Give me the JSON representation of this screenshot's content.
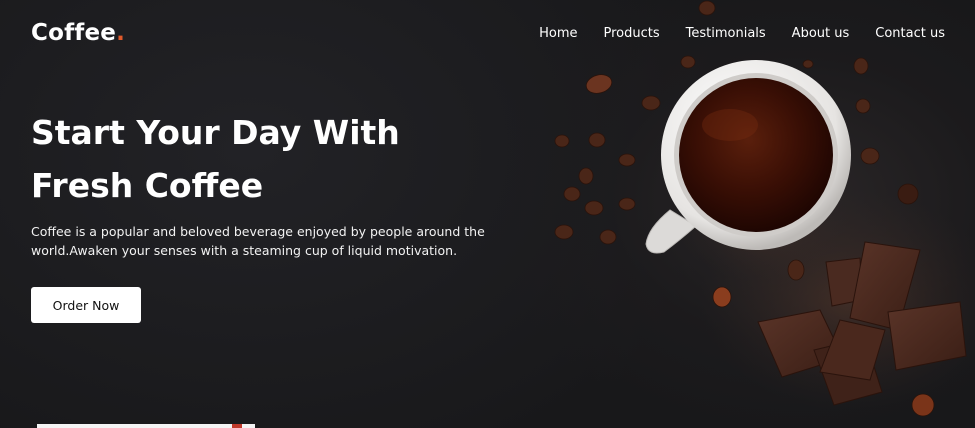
{
  "brand": {
    "name": "Coffee",
    "dot": "."
  },
  "nav": {
    "items": [
      {
        "label": "Home"
      },
      {
        "label": "Products"
      },
      {
        "label": "Testimonials"
      },
      {
        "label": "About us"
      },
      {
        "label": "Contact us"
      }
    ]
  },
  "hero": {
    "headline_line1": "Start Your Day With",
    "headline_line2": "Fresh Coffee",
    "description": "Coffee is a popular and beloved beverage enjoyed by people around the world.Awaken your senses with a steaming cup of liquid motivation.",
    "cta_label": "Order Now"
  },
  "colors": {
    "accent": "#e0592a",
    "background": "#1a1a1c",
    "button_bg": "#ffffff",
    "coffee": "#3a0f05"
  },
  "icons": {
    "hero_image": "coffee-cup-with-beans-and-chocolate"
  }
}
